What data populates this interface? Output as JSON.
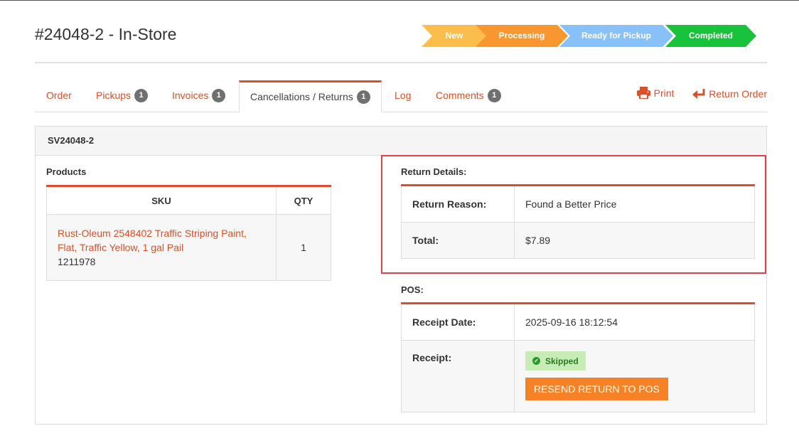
{
  "page": {
    "title": "#24048-2 - In-Store"
  },
  "steps": [
    "New",
    "Processing",
    "Ready for Pickup",
    "Completed"
  ],
  "tabs": {
    "order": "Order",
    "pickups": "Pickups",
    "pickups_count": "1",
    "invoices": "Invoices",
    "invoices_count": "1",
    "cancellations": "Cancellations / Returns",
    "cancellations_count": "1",
    "log": "Log",
    "comments": "Comments",
    "comments_count": "1"
  },
  "actions": {
    "print": "Print",
    "return_order": "Return Order"
  },
  "panel": {
    "header": "SV24048-2"
  },
  "products": {
    "label": "Products",
    "columns": {
      "sku": "SKU",
      "qty": "QTY"
    },
    "rows": [
      {
        "name": "Rust-Oleum 2548402 Traffic Striping Paint, Flat, Traffic Yellow, 1 gal Pail",
        "sku": "1211978",
        "qty": "1"
      }
    ]
  },
  "return_details": {
    "label": "Return Details:",
    "reason_label": "Return Reason:",
    "reason_value": "Found a Better Price",
    "total_label": "Total:",
    "total_value": "$7.89"
  },
  "pos": {
    "label": "POS:",
    "receipt_date_label": "Receipt Date:",
    "receipt_date_value": "2025-09-16 18:12:54",
    "receipt_label": "Receipt:",
    "status": "Skipped",
    "resend_button": "RESEND RETURN TO POS"
  },
  "colors": {
    "accent": "#d9502a",
    "step_new": "#fbbd4b",
    "step_processing": "#f8962f",
    "step_ready": "#88c0f8",
    "step_completed": "#18c23a",
    "highlight": "#e0404a",
    "button": "#f58225"
  }
}
